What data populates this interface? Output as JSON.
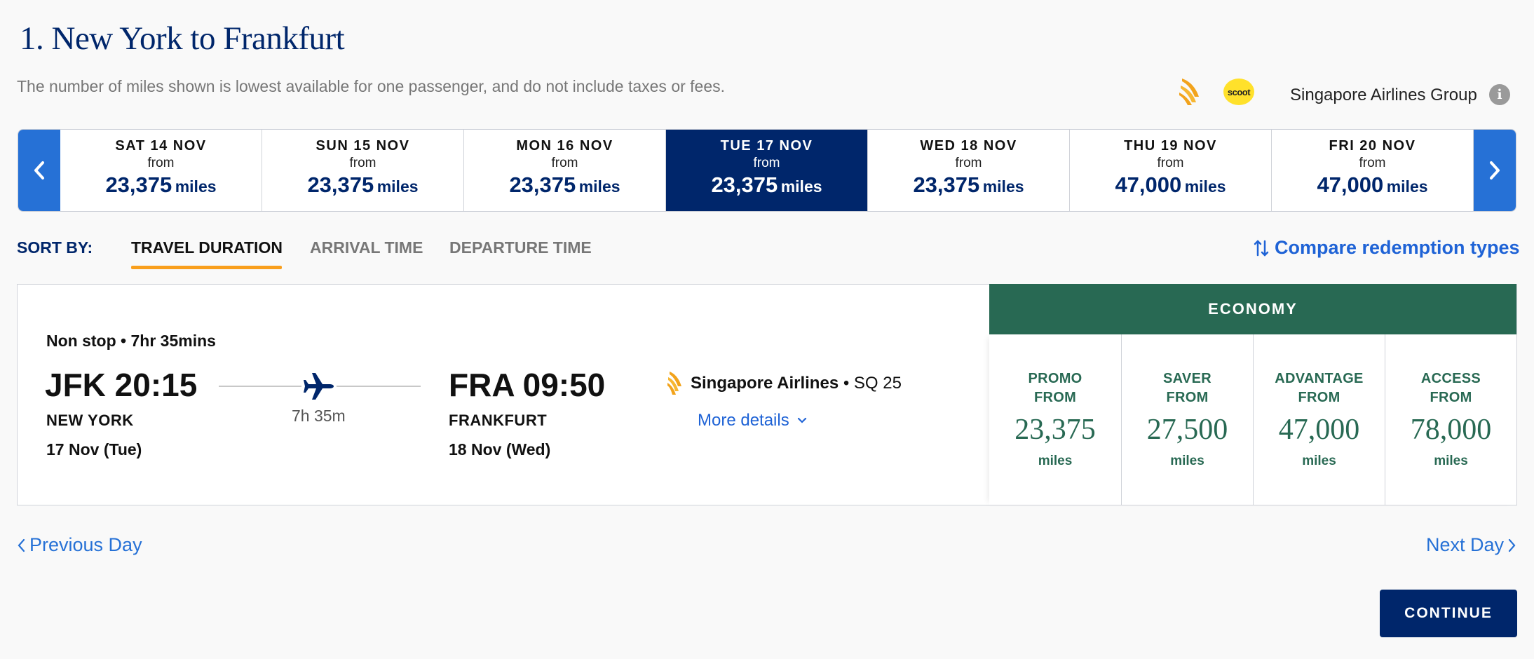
{
  "header": {
    "title": "1. New York to Frankfurt",
    "disclaimer": "The number of miles shown is lowest available for one passenger, and do not include taxes or fees.",
    "scoot_logo_text": "scoot",
    "group_label": "Singapore Airlines Group",
    "info_glyph": "i"
  },
  "date_strip": {
    "prev_icon": "chevron-left-icon",
    "next_icon": "chevron-right-icon",
    "days": [
      {
        "label": "SAT 14 NOV",
        "from": "from",
        "miles": "23,375",
        "unit": "miles",
        "selected": false
      },
      {
        "label": "SUN 15 NOV",
        "from": "from",
        "miles": "23,375",
        "unit": "miles",
        "selected": false
      },
      {
        "label": "MON 16 NOV",
        "from": "from",
        "miles": "23,375",
        "unit": "miles",
        "selected": false
      },
      {
        "label": "TUE 17 NOV",
        "from": "from",
        "miles": "23,375",
        "unit": "miles",
        "selected": true
      },
      {
        "label": "WED 18 NOV",
        "from": "from",
        "miles": "23,375",
        "unit": "miles",
        "selected": false
      },
      {
        "label": "THU 19 NOV",
        "from": "from",
        "miles": "47,000",
        "unit": "miles",
        "selected": false
      },
      {
        "label": "FRI 20 NOV",
        "from": "from",
        "miles": "47,000",
        "unit": "miles",
        "selected": false
      }
    ]
  },
  "sort": {
    "label": "SORT BY:",
    "tabs": [
      "TRAVEL DURATION",
      "ARRIVAL TIME",
      "DEPARTURE TIME"
    ],
    "active_tab": "TRAVEL DURATION",
    "compare_link": "Compare redemption types"
  },
  "flight": {
    "stop_info": "Non stop • 7hr 35mins",
    "departure": {
      "code_time": "JFK 20:15",
      "city": "NEW YORK",
      "date": "17 Nov (Tue)"
    },
    "arrival": {
      "code_time": "FRA 09:50",
      "city": "FRANKFURT",
      "date": "18 Nov (Wed)"
    },
    "duration": "7h 35m",
    "airline": "Singapore Airlines",
    "flight_no": " • SQ 25",
    "more_details": "More details"
  },
  "fares": {
    "cabin": "ECONOMY",
    "columns": [
      {
        "type_line1": "PROMO",
        "type_line2": "FROM",
        "miles": "23,375",
        "unit": "miles"
      },
      {
        "type_line1": "SAVER",
        "type_line2": "FROM",
        "miles": "27,500",
        "unit": "miles"
      },
      {
        "type_line1": "ADVANTAGE",
        "type_line2": "FROM",
        "miles": "47,000",
        "unit": "miles"
      },
      {
        "type_line1": "ACCESS",
        "type_line2": "FROM",
        "miles": "78,000",
        "unit": "miles"
      }
    ]
  },
  "footer": {
    "prev_day": "Previous Day",
    "next_day": "Next Day",
    "continue": "CONTINUE"
  },
  "colors": {
    "brand_navy": "#00266b",
    "accent_blue": "#2671d6",
    "economy_green": "#286953",
    "sort_underline": "#f99f1c"
  }
}
